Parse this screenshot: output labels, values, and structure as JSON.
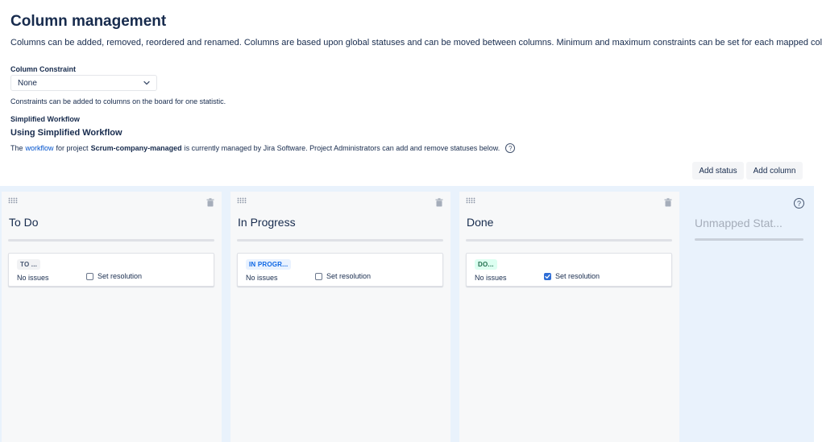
{
  "header": {
    "title": "Column management",
    "description": "Columns can be added, removed, reordered and renamed. Columns are based upon global statuses and can be moved between columns. Minimum and maximum constraints can be set for each mapped column."
  },
  "constraint": {
    "label": "Column Constraint",
    "value": "None",
    "help": "Constraints can be added to columns on the board for one statistic."
  },
  "workflow": {
    "label": "Simplified Workflow",
    "value": "Using Simplified Workflow",
    "desc_prefix": "The",
    "link_text": "workflow",
    "desc_mid": "for project",
    "project": "Scrum-company-managed",
    "desc_suffix": "is currently managed by Jira Software. Project Administrators can add and remove statuses below.",
    "help_glyph": "?"
  },
  "buttons": {
    "add_status": "Add status",
    "add_column": "Add column"
  },
  "columns": [
    {
      "title": "To Do",
      "status": "TO ...",
      "issues": "No issues",
      "resolution_label": "Set resolution",
      "resolution_checked": false
    },
    {
      "title": "In Progress",
      "status": "IN PROGR...",
      "issues": "No issues",
      "resolution_label": "Set resolution",
      "resolution_checked": false
    },
    {
      "title": "Done",
      "status": "DO...",
      "issues": "No issues",
      "resolution_label": "Set resolution",
      "resolution_checked": true
    }
  ],
  "unmapped": {
    "title": "Unmapped Stat...",
    "help_glyph": "?"
  },
  "colors": {
    "link": "#0052cc",
    "board_bg": "#e9f2fc",
    "checkbox_checked": "#2f6ed6"
  }
}
